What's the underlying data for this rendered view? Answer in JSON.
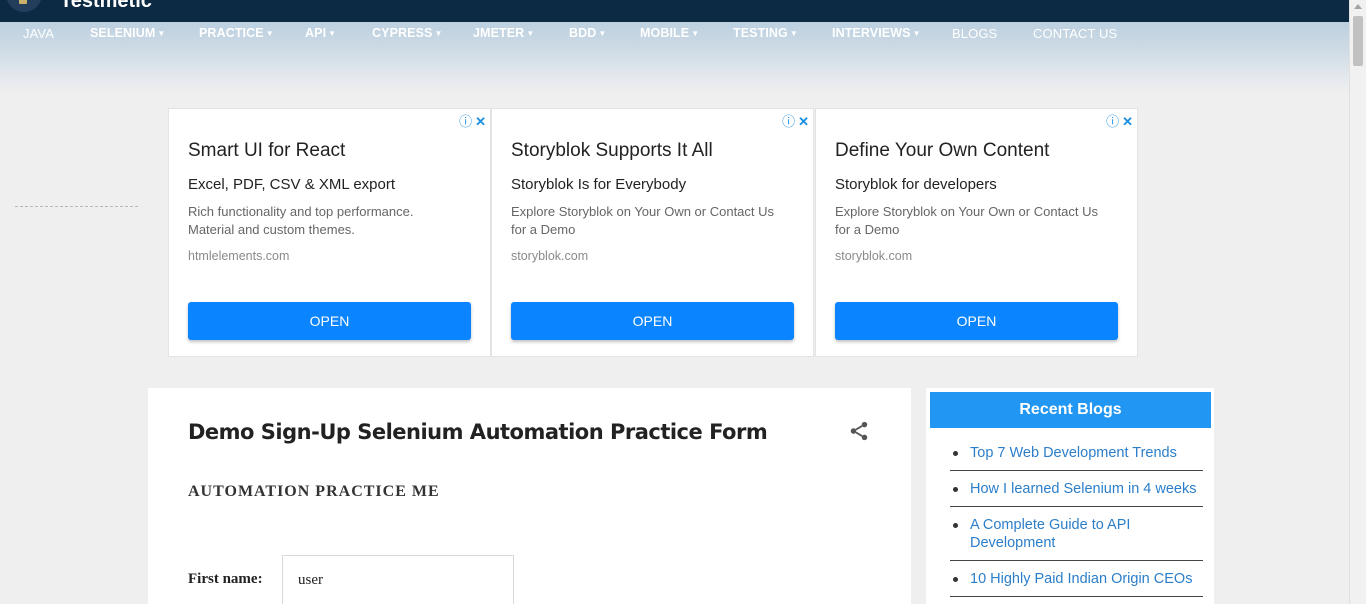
{
  "header": {
    "logo_text": "Testmetic"
  },
  "nav": {
    "items": [
      {
        "label": "JAVA",
        "dropdown": false
      },
      {
        "label": "SELENIUM",
        "dropdown": true
      },
      {
        "label": "PRACTICE",
        "dropdown": true
      },
      {
        "label": "API",
        "dropdown": true
      },
      {
        "label": "CYPRESS",
        "dropdown": true
      },
      {
        "label": "JMETER",
        "dropdown": true
      },
      {
        "label": "BDD",
        "dropdown": true
      },
      {
        "label": "MOBILE",
        "dropdown": true
      },
      {
        "label": "TESTING",
        "dropdown": true
      },
      {
        "label": "INTERVIEWS",
        "dropdown": true
      },
      {
        "label": "BLOGS",
        "dropdown": false
      },
      {
        "label": "CONTACT US",
        "dropdown": false
      }
    ]
  },
  "ads": [
    {
      "title": "Smart UI for React",
      "subtitle": "Excel, PDF, CSV & XML export",
      "description": "Rich functionality and top performance. Material and custom themes.",
      "domain": "htmlelements.com",
      "button": "OPEN"
    },
    {
      "title": "Storyblok Supports It All",
      "subtitle": "Storyblok Is for Everybody",
      "description": "Explore Storyblok on Your Own or Contact Us for a Demo",
      "domain": "storyblok.com",
      "button": "OPEN"
    },
    {
      "title": "Define Your Own Content",
      "subtitle": "Storyblok for developers",
      "description": "Explore Storyblok on Your Own or Contact Us for a Demo",
      "domain": "storyblok.com",
      "button": "OPEN"
    }
  ],
  "ad_controls": {
    "info_icon": "ⓘ",
    "close_icon": "✕"
  },
  "main": {
    "title": "Demo Sign-Up Selenium Automation Practice Form",
    "section_heading": "AUTOMATION PRACTICE ME",
    "first_name_label": "First name:",
    "first_name_value": "user"
  },
  "sidebar": {
    "heading": "Recent Blogs",
    "blogs": [
      "Top 7 Web Development Trends",
      "How I learned Selenium in 4 weeks",
      "A Complete Guide to API Development",
      "10 Highly Paid Indian Origin CEOs"
    ]
  },
  "colors": {
    "header_bg": "#0c2a44",
    "accent_blue": "#0a84ff",
    "sidebar_head": "#2196f3",
    "link": "#2b7ec9"
  }
}
